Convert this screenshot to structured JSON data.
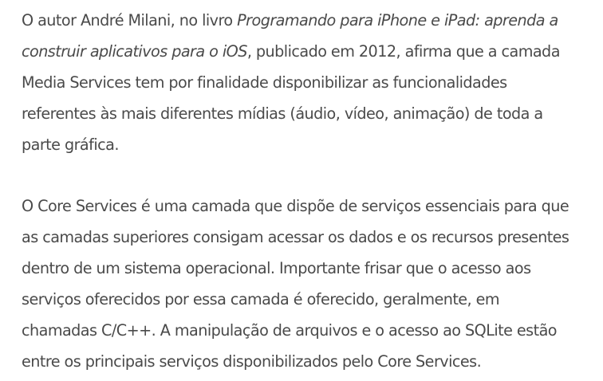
{
  "article": {
    "paragraph_1": {
      "prefix": "O autor André Milani, no livro ",
      "book_title_line1": "Programando para iPhone e iPad: aprenda a",
      "book_title_line2": "construir aplicativos para o iOS",
      "line2_rest": ", publicado em 2012, afirma que a camada",
      "line3": "Media Services tem por finalidade disponibilizar as funcionalidades",
      "line4": "referentes às mais diferentes mídias (áudio, vídeo, animação) de toda a",
      "line5": "parte gráfica."
    },
    "paragraph_2": {
      "lines": [
        "O Core Services é uma camada que dispõe de serviços essenciais para que",
        "as camadas superiores consigam acessar os dados e os recursos presentes",
        "dentro de um sistema operacional. Importante frisar que o acesso aos",
        "serviços oferecidos por essa camada é oferecido, geralmente, em",
        "chamadas C/C++. A manipulação de arquivos e o acesso ao SQLite estão",
        "entre os principais serviços disponibilizados pelo Core Services."
      ]
    }
  }
}
